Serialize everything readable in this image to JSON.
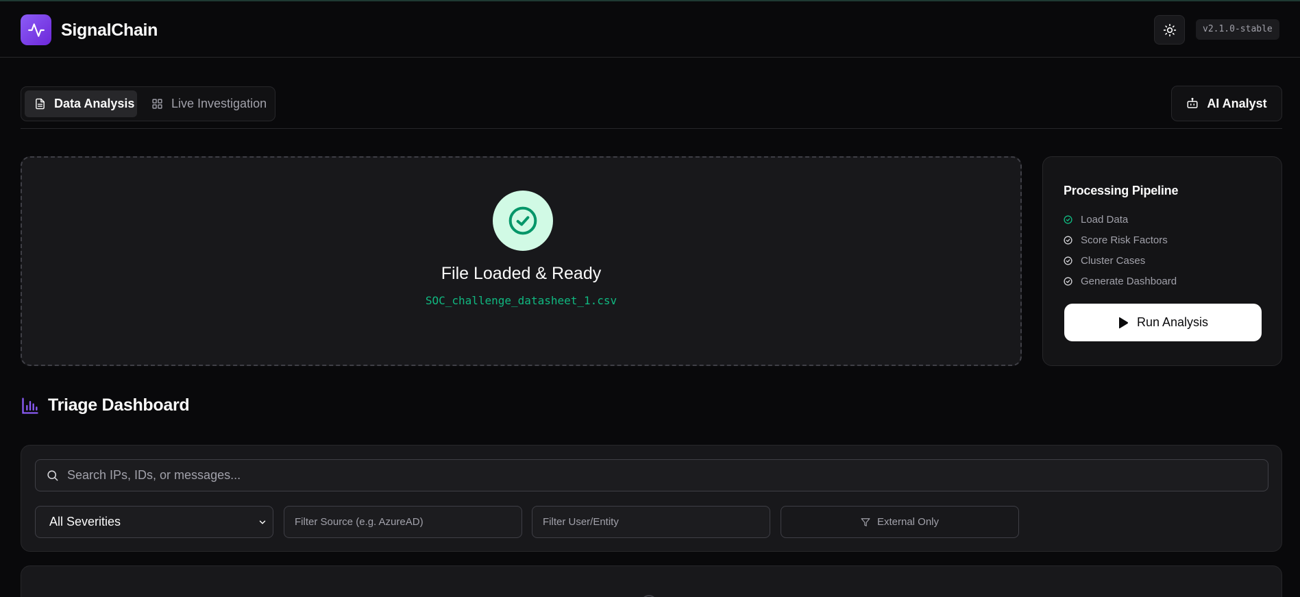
{
  "header": {
    "app_name": "SignalChain",
    "version": "v2.1.0-stable",
    "logo_icon": "activity-pulse-icon",
    "theme_icon": "sun-icon"
  },
  "tabs": [
    {
      "label": "Data Analysis",
      "icon": "file-text-icon",
      "active": true
    },
    {
      "label": "Live Investigation",
      "icon": "layout-grid-icon",
      "active": false
    }
  ],
  "ai_button": {
    "label": "AI Analyst",
    "icon": "bot-icon"
  },
  "upload": {
    "title": "File Loaded & Ready",
    "filename": "SOC_challenge_datasheet_1.csv",
    "status_icon": "check-circle-icon"
  },
  "pipeline": {
    "title": "Processing Pipeline",
    "steps": [
      {
        "label": "Load Data",
        "done": true
      },
      {
        "label": "Score Risk Factors",
        "done": false
      },
      {
        "label": "Cluster Cases",
        "done": false
      },
      {
        "label": "Generate Dashboard",
        "done": false
      }
    ],
    "run_label": "Run Analysis"
  },
  "dashboard": {
    "title": "Triage Dashboard",
    "search_placeholder": "Search IPs, IDs, or messages...",
    "severity_selected": "All Severities",
    "source_placeholder": "Filter Source (e.g. AzureAD)",
    "user_placeholder": "Filter User/Entity",
    "external_label": "External Only"
  },
  "colors": {
    "accent": "#8b5cf6",
    "success": "#10b981",
    "background": "#09090b",
    "card": "#18181b"
  }
}
